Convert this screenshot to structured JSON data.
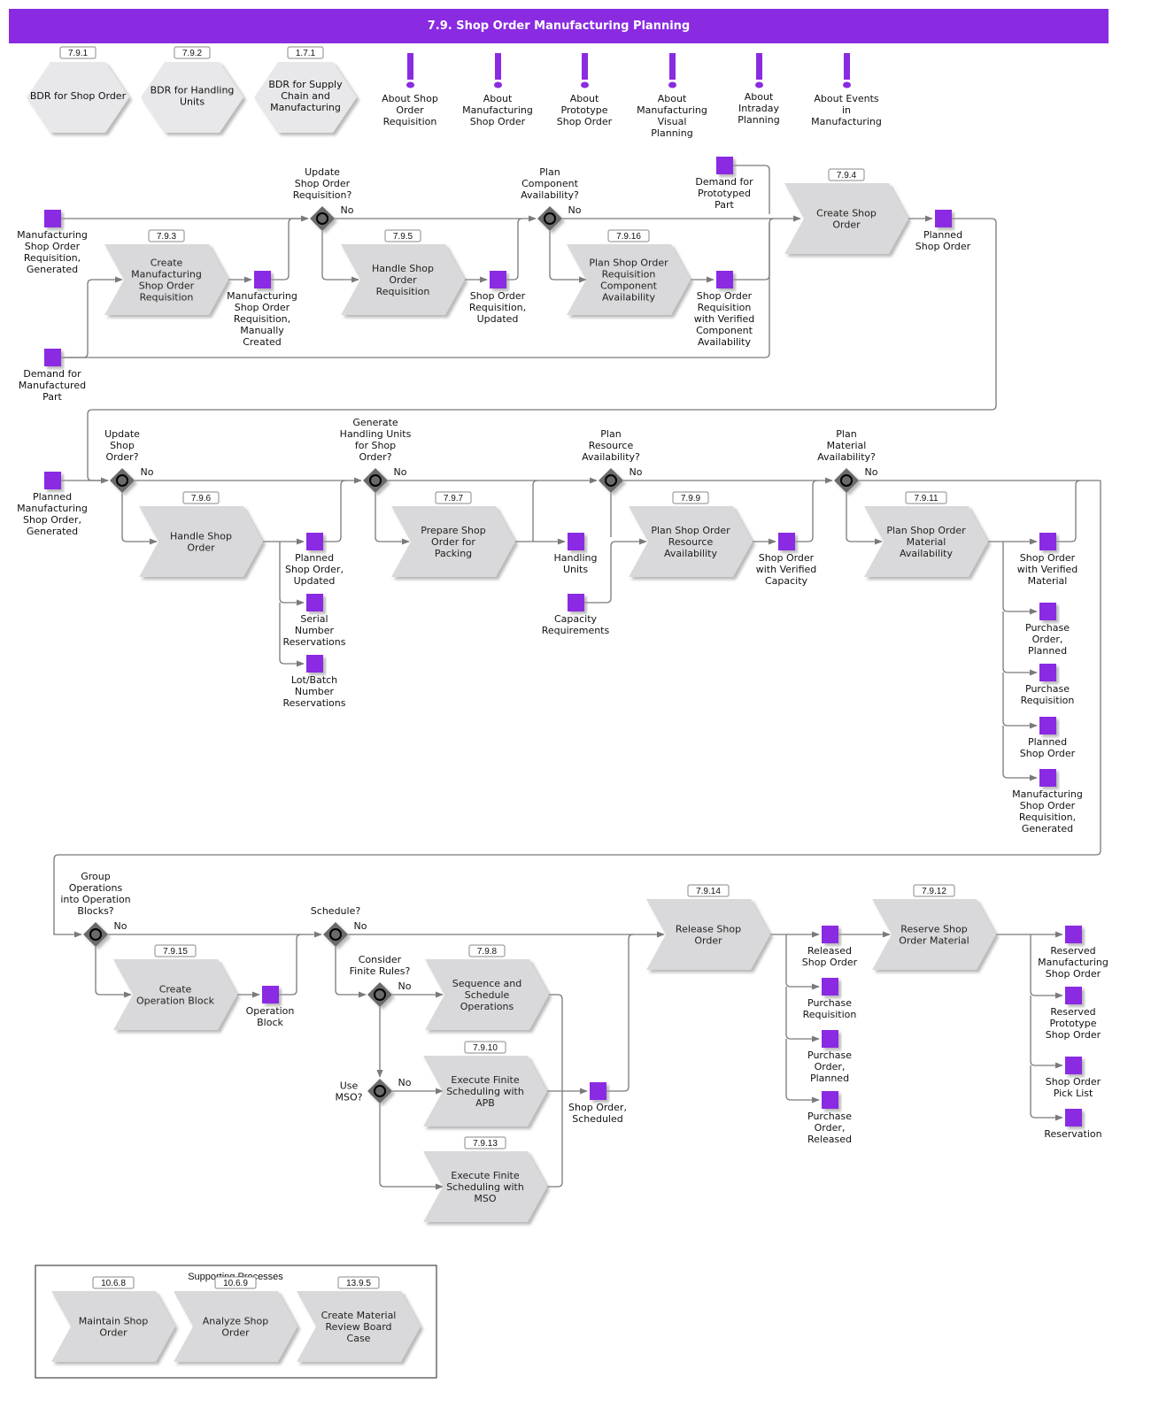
{
  "title": "7.9. Shop Order Manufacturing Planning",
  "colors": {
    "accent": "#8a2be2",
    "process_fill": "#d9d9db",
    "bdr_fill": "#e8e8ea",
    "gateway": "#6b6b6b",
    "line": "#7a7a7a"
  },
  "bdr_items": [
    {
      "ref": "7.9.1",
      "label": "BDR for Shop Order"
    },
    {
      "ref": "7.9.2",
      "label": "BDR for Handling Units"
    },
    {
      "ref": "1.7.1",
      "label": "BDR for Supply Chain and Manufacturing"
    }
  ],
  "about_items": [
    {
      "icon": "exclamation-icon",
      "label": "About Shop Order Requisition"
    },
    {
      "icon": "exclamation-icon",
      "label": "About Manufacturing Shop Order"
    },
    {
      "icon": "exclamation-icon",
      "label": "About Prototype Shop Order"
    },
    {
      "icon": "exclamation-icon",
      "label": "About Manufacturing Visual Planning"
    },
    {
      "icon": "exclamation-icon",
      "label": "About Intraday Planning"
    },
    {
      "icon": "exclamation-icon",
      "label": "About Events in Manufacturing"
    }
  ],
  "processes": [
    {
      "id": "p793",
      "ref": "7.9.3",
      "label": "Create Manufacturing Shop Order Requisition"
    },
    {
      "id": "p795",
      "ref": "7.9.5",
      "label": "Handle Shop Order Requisition"
    },
    {
      "id": "p7916",
      "ref": "7.9.16",
      "label": "Plan Shop Order Requisition Component Availability"
    },
    {
      "id": "p794",
      "ref": "7.9.4",
      "label": "Create Shop Order"
    },
    {
      "id": "p796",
      "ref": "7.9.6",
      "label": "Handle Shop Order"
    },
    {
      "id": "p797",
      "ref": "7.9.7",
      "label": "Prepare Shop Order for Packing"
    },
    {
      "id": "p799",
      "ref": "7.9.9",
      "label": "Plan Shop Order Resource Availability"
    },
    {
      "id": "p7911",
      "ref": "7.9.11",
      "label": "Plan Shop Order Material Availability"
    },
    {
      "id": "p7915",
      "ref": "7.9.15",
      "label": "Create Operation Block"
    },
    {
      "id": "p798",
      "ref": "7.9.8",
      "label": "Sequence and Schedule Operations"
    },
    {
      "id": "p7910",
      "ref": "7.9.10",
      "label": "Execute Finite Scheduling with APB"
    },
    {
      "id": "p7913",
      "ref": "7.9.13",
      "label": "Execute Finite Scheduling with MSO"
    },
    {
      "id": "p7914",
      "ref": "7.9.14",
      "label": "Release Shop Order"
    },
    {
      "id": "p7912",
      "ref": "7.9.12",
      "label": "Reserve Shop Order Material"
    }
  ],
  "gateways": [
    {
      "id": "g1",
      "label": "Update Shop Order Requisition?",
      "no": "No"
    },
    {
      "id": "g2",
      "label": "Plan Component Availability?",
      "no": "No"
    },
    {
      "id": "g3",
      "label": "Update Shop Order?",
      "no": "No"
    },
    {
      "id": "g4",
      "label": "Generate Handling Units for Shop Order?",
      "no": "No"
    },
    {
      "id": "g5",
      "label": "Plan Resource Availability?",
      "no": "No"
    },
    {
      "id": "g6",
      "label": "Plan Material Availability?",
      "no": "No"
    },
    {
      "id": "g7",
      "label": "Group Operations into Operation Blocks?",
      "no": "No"
    },
    {
      "id": "g8",
      "label": "Schedule?",
      "no": "No"
    },
    {
      "id": "g9",
      "label": "Consider Finite Rules?",
      "no": "No"
    },
    {
      "id": "g10",
      "label": "Use MSO?",
      "no": "No"
    }
  ],
  "events": [
    {
      "id": "e1",
      "label": "Manufacturing Shop Order Requisition, Generated"
    },
    {
      "id": "e2",
      "label": "Demand for Manufactured Part"
    },
    {
      "id": "e3",
      "label": "Manufacturing Shop Order Requisition, Manually Created"
    },
    {
      "id": "e4",
      "label": "Shop Order Requisition, Updated"
    },
    {
      "id": "e5",
      "label": "Demand for Prototyped Part"
    },
    {
      "id": "e6",
      "label": "Shop Order Requisition with Verified Component Availability"
    },
    {
      "id": "e7",
      "label": "Planned Shop Order"
    },
    {
      "id": "e8",
      "label": "Planned Manufacturing Shop Order, Generated"
    },
    {
      "id": "e9",
      "label": "Planned Shop Order, Updated"
    },
    {
      "id": "e10",
      "label": "Serial Number Reservations"
    },
    {
      "id": "e11",
      "label": "Lot/Batch Number Reservations"
    },
    {
      "id": "e12",
      "label": "Handling Units"
    },
    {
      "id": "e13",
      "label": "Capacity Requirements"
    },
    {
      "id": "e14",
      "label": "Shop Order with Verified Capacity"
    },
    {
      "id": "e15",
      "label": "Shop Order with Verified Material"
    },
    {
      "id": "e16",
      "label": "Purchase Order, Planned"
    },
    {
      "id": "e17",
      "label": "Purchase Requisition"
    },
    {
      "id": "e18",
      "label": "Planned Shop Order"
    },
    {
      "id": "e19",
      "label": "Manufacturing Shop Order Requisition, Generated"
    },
    {
      "id": "e20",
      "label": "Operation Block"
    },
    {
      "id": "e21",
      "label": "Shop Order, Scheduled"
    },
    {
      "id": "e22",
      "label": "Released Shop Order"
    },
    {
      "id": "e23",
      "label": "Purchase Requisition"
    },
    {
      "id": "e24",
      "label": "Purchase Order, Planned"
    },
    {
      "id": "e25",
      "label": "Purchase Order, Released"
    },
    {
      "id": "e26",
      "label": "Reserved Manufacturing Shop Order"
    },
    {
      "id": "e27",
      "label": "Reserved Prototype Shop Order"
    },
    {
      "id": "e28",
      "label": "Shop Order Pick List"
    },
    {
      "id": "e29",
      "label": "Reservation"
    }
  ],
  "supporting": {
    "title": "Supporting Processes",
    "items": [
      {
        "ref": "10.6.8",
        "label": "Maintain Shop Order"
      },
      {
        "ref": "10.6.9",
        "label": "Analyze Shop Order"
      },
      {
        "ref": "13.9.5",
        "label": "Create Material Review Board Case"
      }
    ]
  }
}
